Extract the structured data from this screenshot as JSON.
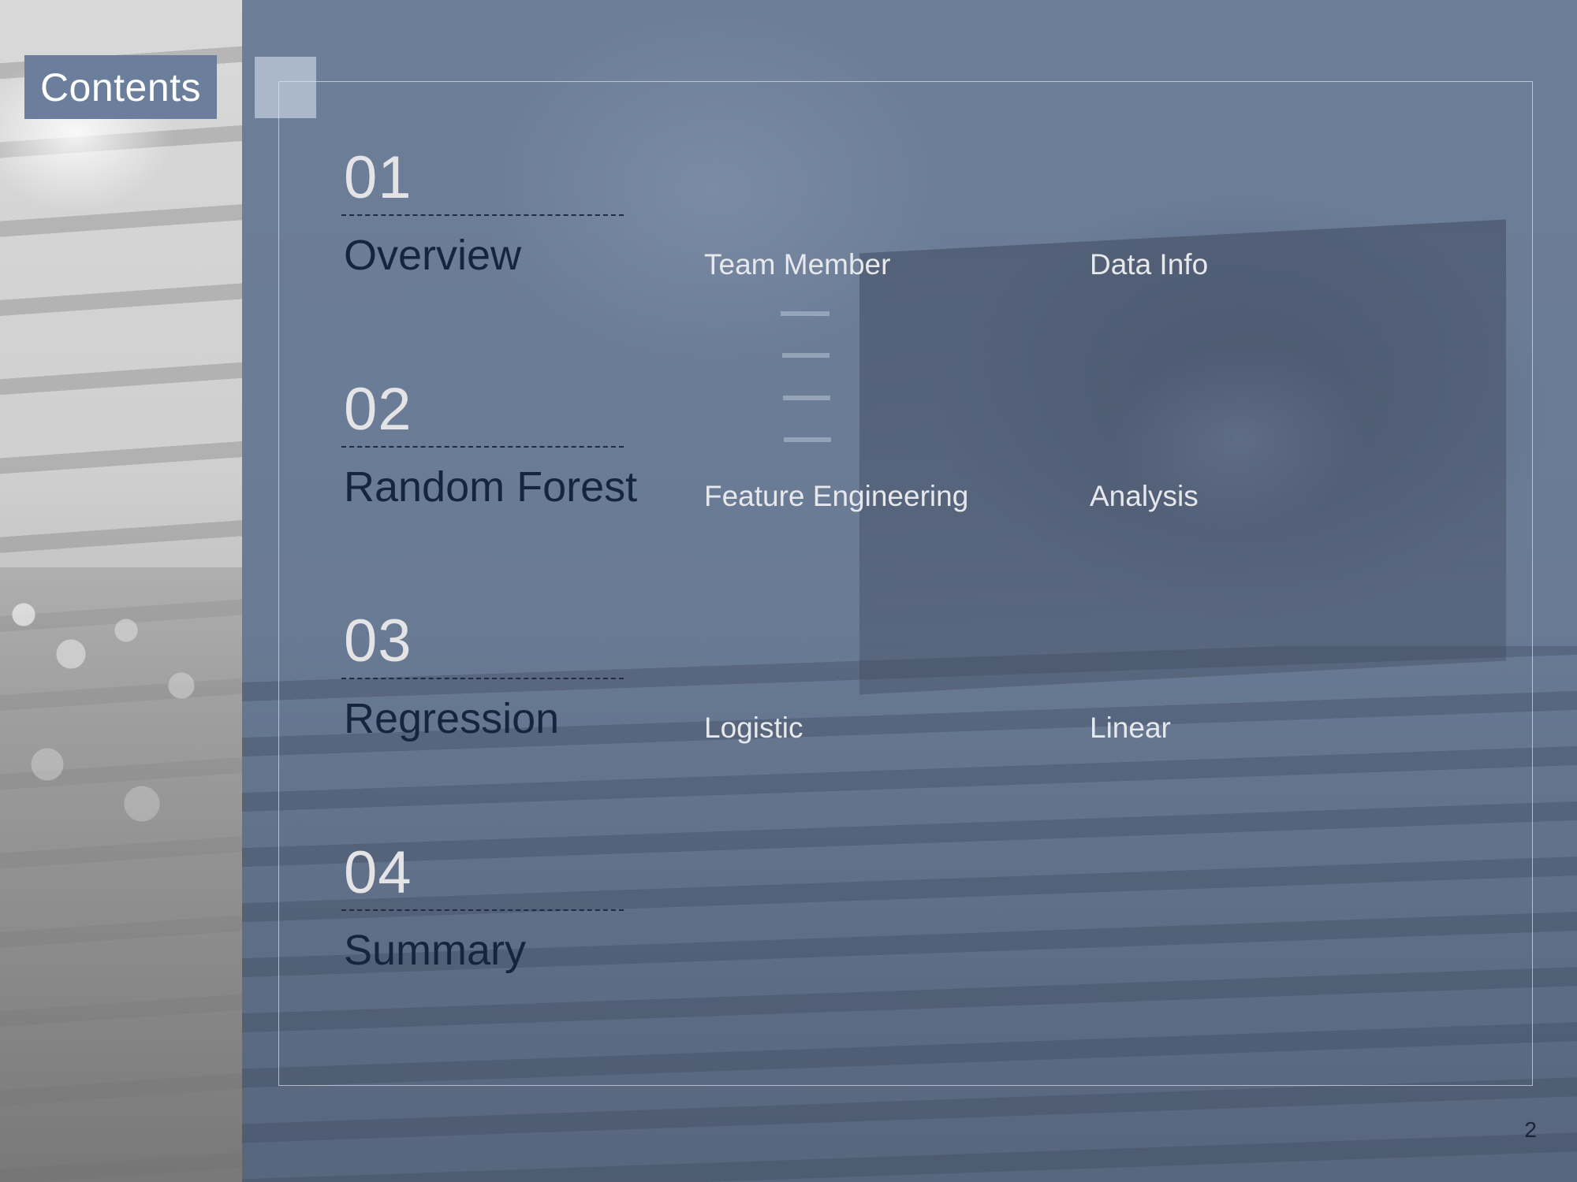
{
  "slide": {
    "heading": "Contents",
    "page_number": "2"
  },
  "sections": [
    {
      "number": "01",
      "title": "Overview",
      "subtopics": [
        "Team Member",
        "Data Info"
      ]
    },
    {
      "number": "02",
      "title": "Random Forest",
      "subtopics": [
        "Feature Engineering",
        "Analysis"
      ]
    },
    {
      "number": "03",
      "title": "Regression",
      "subtopics": [
        "Logistic",
        "Linear"
      ]
    },
    {
      "number": "04",
      "title": "Summary",
      "subtopics": []
    }
  ],
  "colors": {
    "overlay": "#6e7f99",
    "label_bg": "#6b7e9b",
    "title_text": "#17243d",
    "number_text": "#e4e4e6",
    "subtopic_text": "#e6e8ec"
  }
}
